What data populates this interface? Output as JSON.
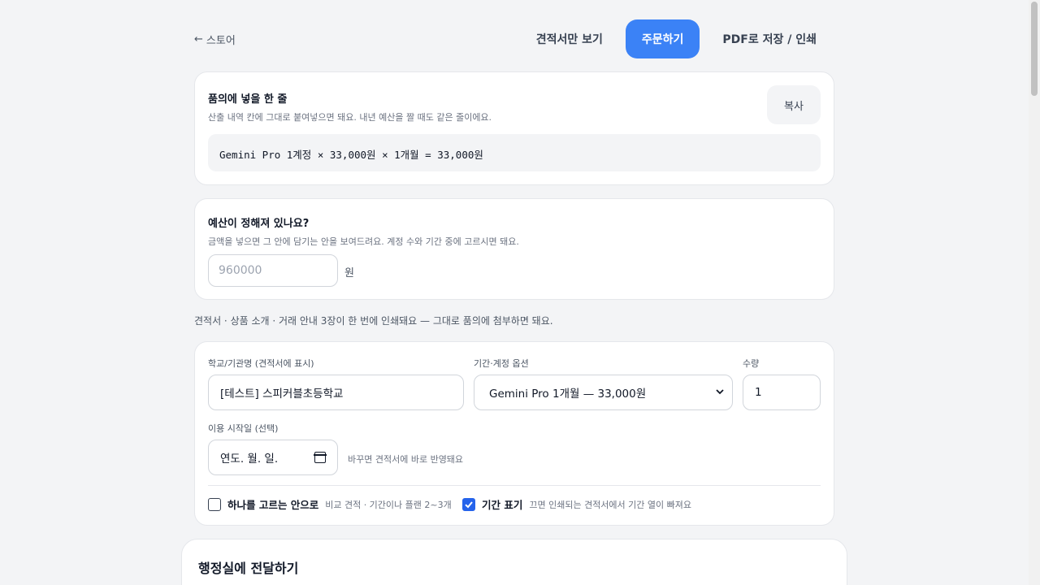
{
  "nav": {
    "back_label": "스토어",
    "view_quote_label": "견적서만 보기",
    "order_label": "주문하기",
    "pdf_label": "PDF로 저장 / 인쇄"
  },
  "approval_line": {
    "title": "품의에 넣을 한 줄",
    "subtitle": "산출 내역 칸에 그대로 붙여넣으면 돼요. 내년 예산을 짤 때도 같은 줄이에요.",
    "copy_label": "복사",
    "line_text": "Gemini Pro 1계정 × 33,000원 × 1개월 = 33,000원"
  },
  "budget": {
    "title": "예산이 정해져 있나요?",
    "subtitle": "금액을 넣으면 그 안에 담기는 안을 보여드려요. 계정 수와 기간 중에 고르시면 돼요.",
    "placeholder": "960000",
    "unit": "원"
  },
  "print_notice": "견적서 · 상품 소개 · 거래 안내 3장이 한 번에 인쇄돼요 — 그대로 품의에 첨부하면 돼요.",
  "form": {
    "school_label": "학교/기관명 (견적서에 표시)",
    "school_value": "[테스트] 스피커블초등학교",
    "option_label": "기간·계정 옵션",
    "option_value": "Gemini Pro 1개월 — 33,000원",
    "qty_label": "수량",
    "qty_value": "1",
    "start_label": "이용 시작일 (선택)",
    "start_value": "연도. 월. 일.",
    "start_hint": "바꾸면 견적서에 바로 반영돼요",
    "single_option_label": "하나를 고르는 안으로",
    "single_option_desc": "비교 견적 · 기간이나 플랜 2~3개",
    "single_option_checked": false,
    "show_period_label": "기간 표기",
    "show_period_desc": "끄면 인쇄되는 견적서에서 기간 열이 빠져요",
    "show_period_checked": true
  },
  "handoff": {
    "title": "행정실에 전달하기"
  },
  "colors": {
    "accent": "#3b82f6",
    "checkbox_on": "#2563eb"
  }
}
